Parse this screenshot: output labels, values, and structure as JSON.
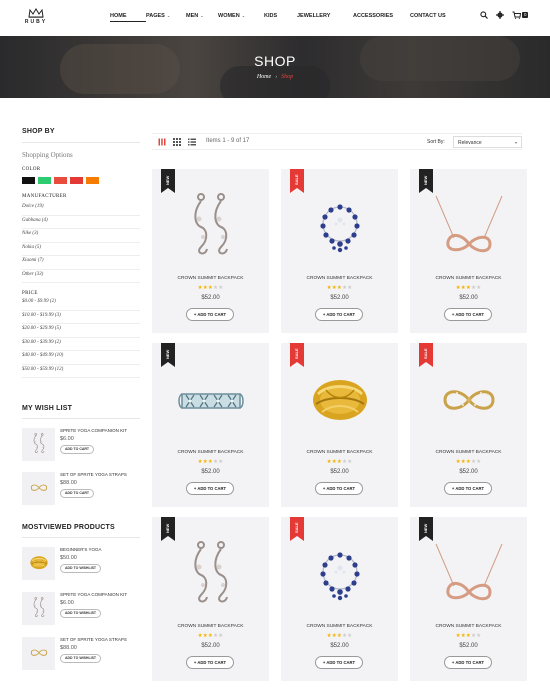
{
  "brand": {
    "name": "RUBY"
  },
  "nav": {
    "items": [
      {
        "label": "HOME",
        "dropdown": false,
        "active": true
      },
      {
        "label": "PAGES",
        "dropdown": true
      },
      {
        "label": "MEN",
        "dropdown": true
      },
      {
        "label": "WOMEN",
        "dropdown": true
      },
      {
        "label": "KIDS",
        "dropdown": false
      },
      {
        "label": "JEWELLERY",
        "dropdown": false
      },
      {
        "label": "ACCESSORIES",
        "dropdown": false
      },
      {
        "label": "CONTACT US",
        "dropdown": false
      }
    ],
    "cart_count": "0",
    "icons": [
      "search-icon",
      "gear-icon",
      "cart-icon"
    ]
  },
  "banner": {
    "title": "SHOP",
    "breadcrumb": {
      "home": "Home",
      "current": "Shop"
    }
  },
  "sidebar": {
    "shop_by": "SHOP BY",
    "shopping_options": "Shopping Options",
    "color_label": "COLOR",
    "colors": [
      "#111111",
      "#2ecc71",
      "#e74c3c",
      "#e53935",
      "#f57c00"
    ],
    "manufacturer_label": "MANUFACTURER",
    "manufacturers": [
      "Dolce (19)",
      "Gabbana (4)",
      "Nike (3)",
      "Nokia (5)",
      "Xiaomi (7)",
      "Other (33)"
    ],
    "price_label": "PRICE",
    "prices": [
      "$0.00 - $9.99 (2)",
      "$10.00 - $19.99 (3)",
      "$20.00 - $29.99 (5)",
      "$30.00 - $39.99 (2)",
      "$40.00 - $49.99 (10)",
      "$50.00 - $59.99 (12)"
    ],
    "wishlist": {
      "title": "MY WISH LIST",
      "items": [
        {
          "name": "SPRITE YOGA COMPANION KIT",
          "price": "$6.00",
          "button": "ADD TO CART"
        },
        {
          "name": "SET OF SPRITE YOGA STRAPS",
          "price": "$88.00",
          "button": "ADD TO CART"
        }
      ]
    },
    "mostviewed": {
      "title": "MOSTVIEWED PRODUCTS",
      "items": [
        {
          "name": "BEGINNER'S YOGA",
          "price": "$50.00",
          "button": "ADD TO WISHLIST"
        },
        {
          "name": "SPRITE YOGA COMPANION KIT",
          "price": "$6.00",
          "button": "ADD TO WISHLIST"
        },
        {
          "name": "SET OF SPRITE YOGA STRAPS",
          "price": "$88.00",
          "button": "ADD TO WISHLIST"
        }
      ]
    }
  },
  "toolbar": {
    "items_count": "Items 1 - 9 of 17",
    "sort_label": "Sort By:",
    "sort_value": "Relevance"
  },
  "products": [
    {
      "badge": "NEW",
      "badge_color": "#222222",
      "name": "CROWN SUMMIT BACKPACK",
      "rating": 3,
      "price": "$52.00",
      "button": "+ ADD TO CART",
      "image": "earrings-icon"
    },
    {
      "badge": "SALE",
      "badge_color": "#e53935",
      "name": "CROWN SUMMIT BACKPACK",
      "rating": 3,
      "price": "$52.00",
      "button": "+ ADD TO CART",
      "image": "sapphire-necklace-icon"
    },
    {
      "badge": "NEW",
      "badge_color": "#222222",
      "name": "CROWN SUMMIT BACKPACK",
      "rating": 3,
      "price": "$52.00",
      "button": "+ ADD TO CART",
      "image": "infinity-necklace-icon"
    },
    {
      "badge": "NEW",
      "badge_color": "#222222",
      "name": "CROWN SUMMIT BACKPACK",
      "rating": 3,
      "price": "$52.00",
      "button": "+ ADD TO CART",
      "image": "diamond-ring-icon"
    },
    {
      "badge": "SALE",
      "badge_color": "#e53935",
      "name": "CROWN SUMMIT BACKPACK",
      "rating": 3,
      "price": "$52.00",
      "button": "+ ADD TO CART",
      "image": "gold-ring-icon"
    },
    {
      "badge": "SALE",
      "badge_color": "#e53935",
      "name": "CROWN SUMMIT BACKPACK",
      "rating": 3,
      "price": "$52.00",
      "button": "+ ADD TO CART",
      "image": "bow-ring-icon"
    },
    {
      "badge": "NEW",
      "badge_color": "#222222",
      "name": "CROWN SUMMIT BACKPACK",
      "rating": 3,
      "price": "$52.00",
      "button": "+ ADD TO CART",
      "image": "earrings-icon"
    },
    {
      "badge": "SALE",
      "badge_color": "#e53935",
      "name": "CROWN SUMMIT BACKPACK",
      "rating": 3,
      "price": "$52.00",
      "button": "+ ADD TO CART",
      "image": "sapphire-necklace-icon"
    },
    {
      "badge": "NEW",
      "badge_color": "#222222",
      "name": "CROWN SUMMIT BACKPACK",
      "rating": 3,
      "price": "$52.00",
      "button": "+ ADD TO CART",
      "image": "infinity-necklace-icon"
    }
  ]
}
